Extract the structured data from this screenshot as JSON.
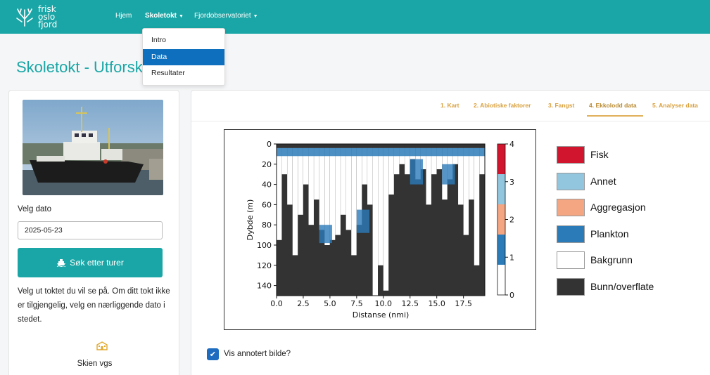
{
  "nav": {
    "logo_lines": [
      "frisk",
      "oslo",
      "fjord"
    ],
    "items": [
      {
        "label": "Hjem"
      },
      {
        "label": "Skoletokt"
      },
      {
        "label": "Fjordobservatoriet"
      }
    ],
    "dropdown": [
      {
        "label": "Intro"
      },
      {
        "label": "Data"
      },
      {
        "label": "Resultater"
      }
    ]
  },
  "page_title": "Skoletokt - Utforsk",
  "sidebar": {
    "date_label": "Velg dato",
    "date_value": "2025-05-23",
    "search_button": "Søk etter turer",
    "help_text": "Velg ut toktet du vil se på. Om ditt tokt ikke er tilgjengelig, velg en nærliggende dato i stedet.",
    "school_icon": "school-icon",
    "school_name": "Skien vgs"
  },
  "tabs": [
    {
      "label": "1. Kart"
    },
    {
      "label": "2. Abiotiske faktorer"
    },
    {
      "label": "3. Fangst"
    },
    {
      "label": "4. Ekkolodd data"
    },
    {
      "label": "5. Analyser data"
    }
  ],
  "legend": [
    {
      "label": "Fisk",
      "color": "#d1152e"
    },
    {
      "label": "Annet",
      "color": "#92c5de"
    },
    {
      "label": "Aggregasjon",
      "color": "#f4a582"
    },
    {
      "label": "Plankton",
      "color": "#2b7bb9"
    },
    {
      "label": "Bakgrunn",
      "color": "#ffffff"
    },
    {
      "label": "Bunn/overflate",
      "color": "#333333"
    }
  ],
  "show_annotated": {
    "label": "Vis annotert bilde?",
    "checked": true
  },
  "chart_data": {
    "type": "heatmap",
    "xlabel": "Distanse (nmi)",
    "ylabel": "Dybde (m)",
    "x_ticks": [
      "0.0",
      "2.5",
      "5.0",
      "7.5",
      "10.0",
      "12.5",
      "15.0",
      "17.5"
    ],
    "y_ticks": [
      "0",
      "20",
      "40",
      "60",
      "80",
      "100",
      "120",
      "140"
    ],
    "xlim": [
      0,
      19.5
    ],
    "ylim": [
      150,
      0
    ],
    "colorbar": {
      "ticks": [
        "0",
        "1",
        "2",
        "3",
        "4"
      ],
      "range": [
        0,
        4
      ],
      "classes": [
        {
          "value": 0,
          "color": "#ffffff"
        },
        {
          "value": 1,
          "color": "#2b7bb9"
        },
        {
          "value": 2,
          "color": "#f4a582"
        },
        {
          "value": 3,
          "color": "#92c5de"
        },
        {
          "value": 4,
          "color": "#d1152e"
        }
      ]
    },
    "bottom_depth_profile": {
      "x": [
        0.0,
        0.5,
        1.0,
        1.5,
        2.0,
        2.5,
        3.0,
        3.5,
        4.0,
        4.5,
        5.0,
        5.5,
        6.0,
        6.5,
        7.0,
        7.5,
        8.0,
        8.5,
        9.0,
        9.5,
        10.0,
        10.5,
        11.0,
        11.5,
        12.0,
        12.5,
        13.0,
        13.5,
        14.0,
        14.5,
        15.0,
        15.5,
        16.0,
        16.5,
        17.0,
        17.5,
        18.0,
        18.5,
        19.0,
        19.5
      ],
      "depth": [
        95,
        30,
        60,
        110,
        70,
        40,
        80,
        55,
        85,
        100,
        95,
        90,
        70,
        85,
        110,
        80,
        40,
        60,
        150,
        120,
        145,
        50,
        30,
        20,
        30,
        15,
        35,
        25,
        60,
        30,
        25,
        55,
        35,
        20,
        60,
        90,
        55,
        120,
        30,
        25
      ]
    }
  }
}
